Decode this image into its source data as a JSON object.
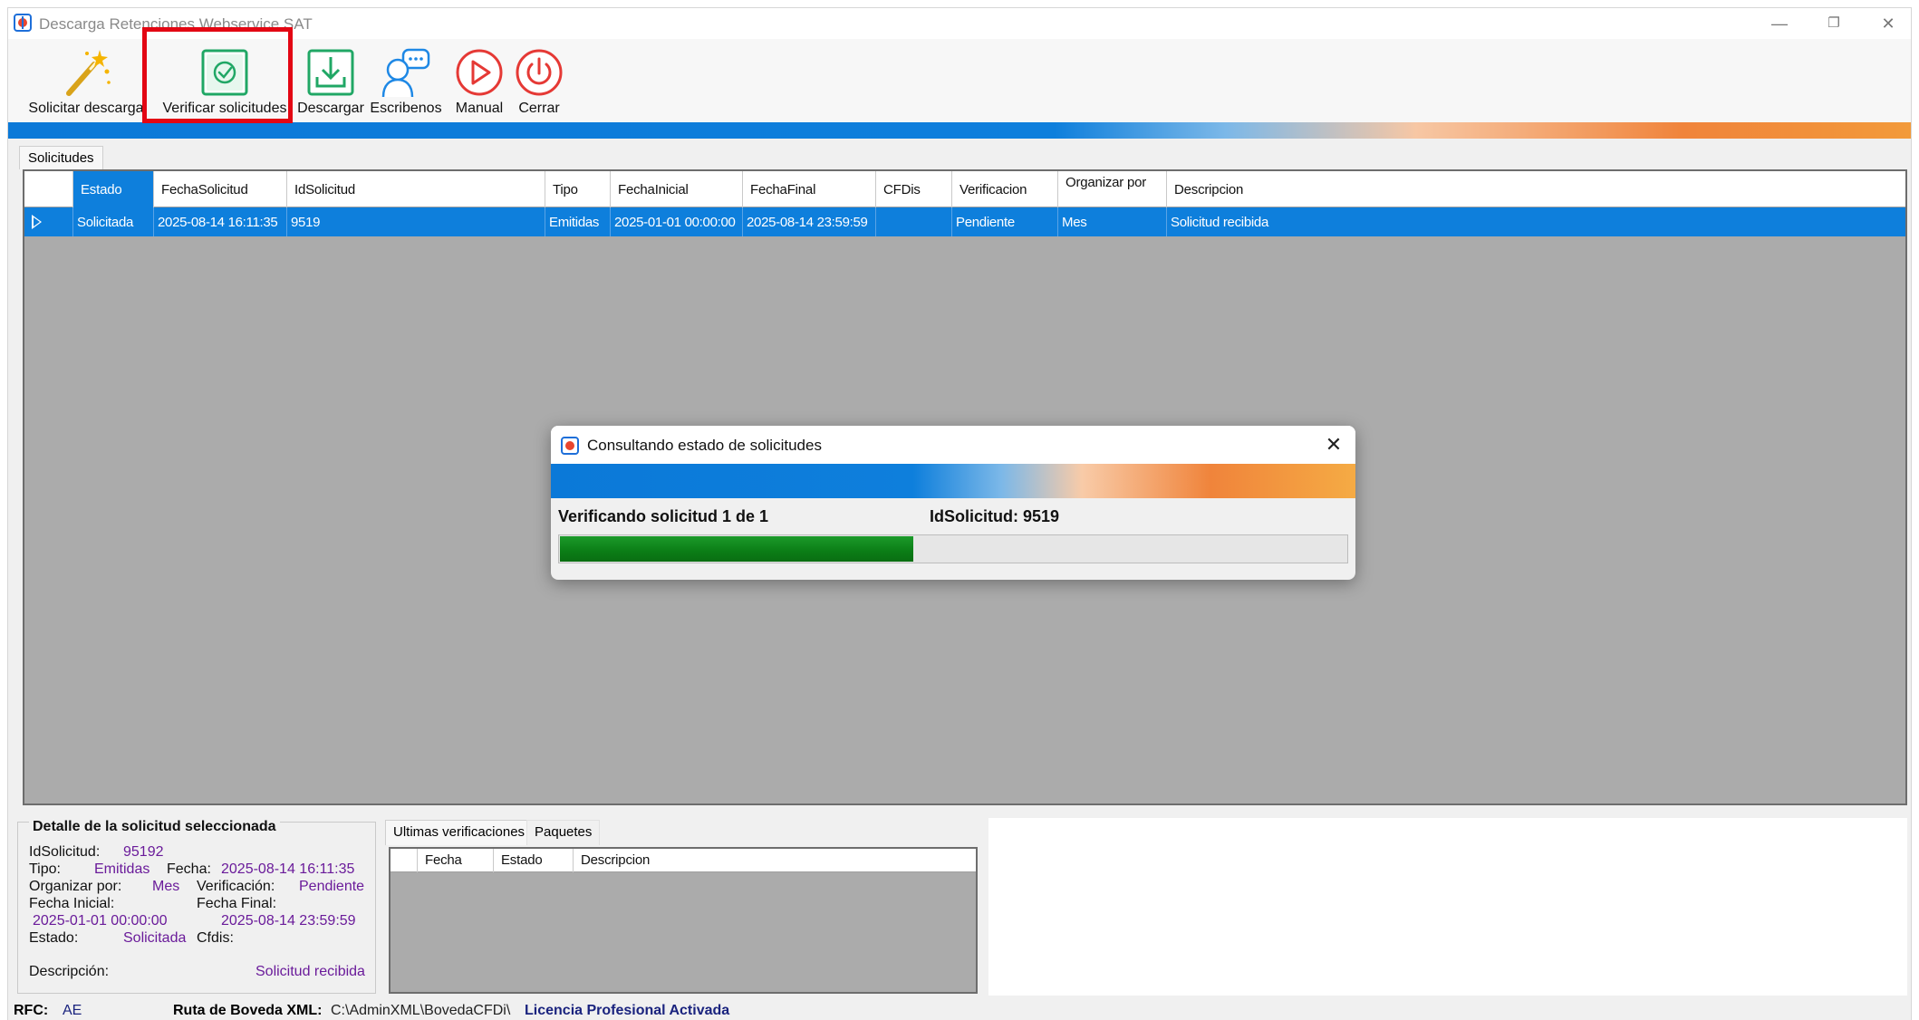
{
  "window": {
    "title": "Descarga Retenciones Webservice SAT",
    "controls": {
      "minimize": "—",
      "restore": "❐",
      "close": "✕"
    }
  },
  "toolbar": {
    "items": [
      {
        "label": "Solicitar descarga",
        "icon": "magic-wand-icon"
      },
      {
        "label": "Verificar solicitudes",
        "icon": "check-square-icon"
      },
      {
        "label": "Descargar",
        "icon": "download-tray-icon"
      },
      {
        "label": "Escribenos",
        "icon": "chat-user-icon"
      },
      {
        "label": "Manual",
        "icon": "play-circle-icon"
      },
      {
        "label": "Cerrar",
        "icon": "power-icon"
      }
    ],
    "highlight_color": "#e30613"
  },
  "tabs": {
    "solicitudes": "Solicitudes"
  },
  "grid": {
    "columns": [
      "Estado",
      "FechaSolicitud",
      "IdSolicitud",
      "Tipo",
      "FechaInicial",
      "FechaFinal",
      "CFDis",
      "Verificacion",
      "Organizar por",
      "Descripcion"
    ],
    "sorted_column": "Estado",
    "rows": [
      {
        "estado": "Solicitada",
        "fecha_solicitud": "2025-08-14 16:11:35",
        "id_solicitud": "9519",
        "tipo": "Emitidas",
        "fecha_inicial": "2025-01-01 00:00:00",
        "fecha_final": "2025-08-14 23:59:59",
        "cfdis": "",
        "verificacion": "Pendiente",
        "organizar_por": "Mes",
        "descripcion": "Solicitud recibida"
      }
    ],
    "selection_color": "#0e7fdc"
  },
  "modal": {
    "title": "Consultando estado de solicitudes",
    "status": "Verificando solicitud 1 de 1",
    "id_label": "IdSolicitud: 9519",
    "progress": 0.45,
    "progress_color": "#0b7d16"
  },
  "detail": {
    "title": "Detalle de la solicitud seleccionada",
    "id_label": "IdSolicitud:",
    "id_value": "95192",
    "tipo_label": "Tipo:",
    "tipo_value": "Emitidas",
    "fecha_label": "Fecha:",
    "fecha_value": "2025-08-14 16:11:35",
    "organizar_label": "Organizar por:",
    "organizar_value": "Mes",
    "verificacion_label": "Verificación:",
    "verificacion_value": "Pendiente",
    "fecha_inicial_label": "Fecha Inicial:",
    "fecha_inicial_value": "2025-01-01 00:00:00",
    "fecha_final_label": "Fecha Final:",
    "fecha_final_value": "2025-08-14 23:59:59",
    "estado_label": "Estado:",
    "estado_value": "Solicitada",
    "cfdis_label": "Cfdis:",
    "descripcion_label": "Descripción:",
    "descripcion_value": "Solicitud recibida",
    "value_color": "#6a1b9a"
  },
  "bottom_tabs": [
    "Ultimas verificaciones",
    "Paquetes"
  ],
  "bottom_grid": {
    "columns": [
      "Fecha",
      "Estado",
      "Descripcion"
    ]
  },
  "statusbar": {
    "rfc_label": "RFC:",
    "rfc_value": "AE",
    "ruta_label": "Ruta de Boveda XML:",
    "ruta_value": "C:\\AdminXML\\BovedaCFDi\\",
    "licencia": "Licencia Profesional Activada"
  }
}
